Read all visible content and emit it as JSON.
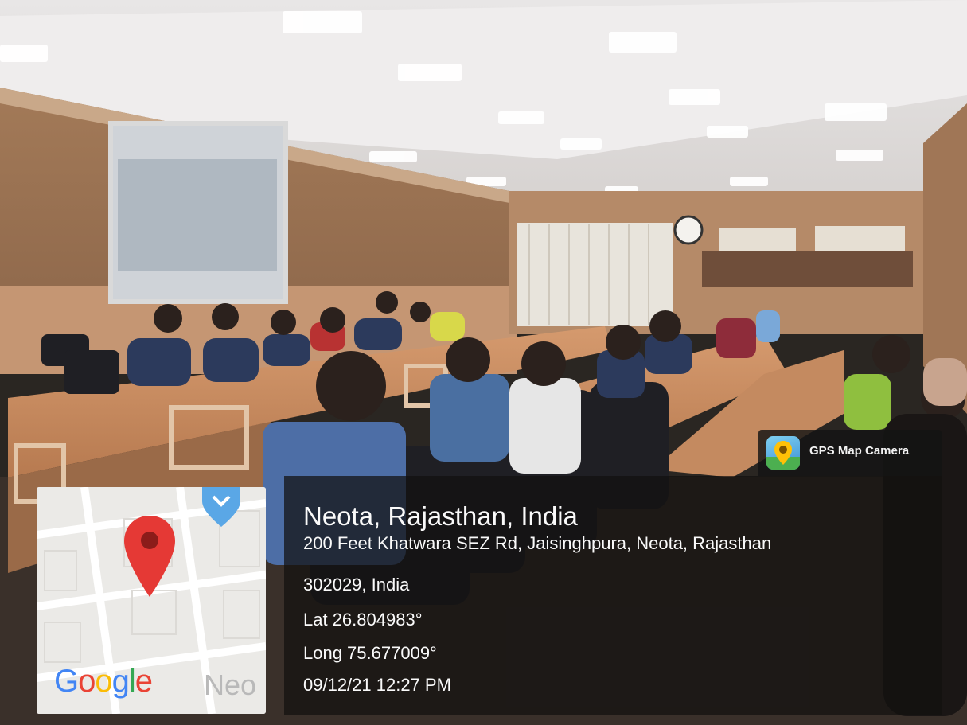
{
  "overlay": {
    "app_name": "GPS Map Camera",
    "app_icon": "gps-map-camera-icon",
    "location_title": "Neota, Rajasthan, India",
    "address_line1": "200 Feet Khatwara SEZ Rd, Jaisinghpura, Neota, Rajasthan",
    "address_line2": "302029, India",
    "latitude": "Lat 26.804983°",
    "longitude": "Long 75.677009°",
    "datetime": "09/12/21 12:27 PM"
  },
  "map": {
    "brand_letters": [
      "G",
      "o",
      "o",
      "g",
      "l",
      "e"
    ],
    "place_label": "Neo",
    "pin_icon": "map-pin-icon",
    "poi_icon": "poi-marker-icon",
    "pin_color": "#e53935"
  },
  "colors": {
    "panel_bg": "#121010",
    "text": "#fafafa",
    "google_blue": "#4285f4",
    "google_red": "#ea4335",
    "google_yellow": "#fbbc05",
    "google_green": "#34a853"
  }
}
